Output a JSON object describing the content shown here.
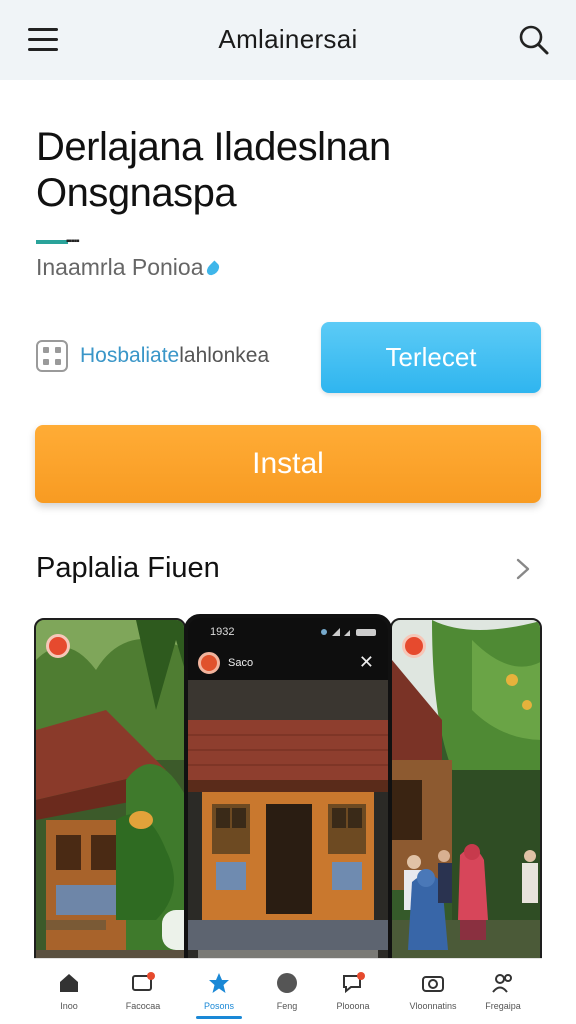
{
  "topbar": {
    "title": "Amlainersai",
    "menu_icon": "hamburger-menu-icon",
    "search_icon": "search-icon"
  },
  "app": {
    "title_line1": "Derlajana Iladeslnan",
    "title_line2": "Onsgnaspa",
    "mark_text": "▪▪▪▪▪",
    "developer": "Inaamrla Ponioa",
    "rating_label_accent": "Hosbaliate",
    "rating_label_rest": "lahlonkea",
    "secondary_button": "Terlecet",
    "install_button": "Instal"
  },
  "colors": {
    "accent_blue": "#2fb5ef",
    "install_orange": "#f89b22",
    "teal_mark": "#2aa39a",
    "nav_active": "#1a88d6"
  },
  "screenshots": {
    "section_title": "Paplalia Fiuen",
    "middle": {
      "status_time": "1932",
      "app_label": "Saco"
    },
    "nav": [
      {
        "label": "Inoo",
        "icon": "home-icon"
      },
      {
        "label": "Facocaa",
        "icon": "image-icon"
      },
      {
        "label": "Posons",
        "icon": "star-icon",
        "active": true
      },
      {
        "label": "Feng",
        "icon": "circle-icon"
      },
      {
        "label": "Plooona",
        "icon": "chat-bubble-icon"
      },
      {
        "label": "Vloonnatins",
        "icon": "camera-icon"
      },
      {
        "label": "Fregaipa",
        "icon": "people-icon"
      }
    ]
  }
}
